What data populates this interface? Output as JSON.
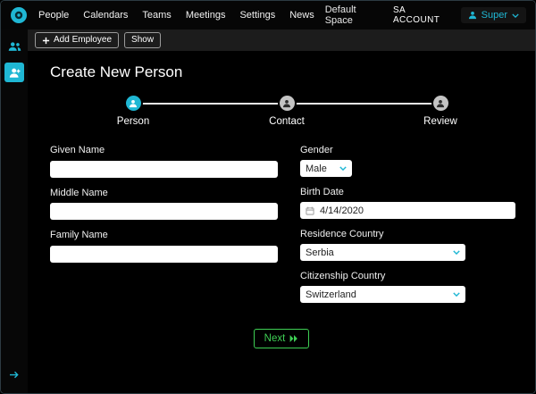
{
  "colors": {
    "accent": "#1fb7d4",
    "success": "#3ecf54"
  },
  "navbar": {
    "items": [
      "People",
      "Calendars",
      "Teams",
      "Meetings",
      "Settings",
      "News"
    ],
    "space_label": "Default Space",
    "account_label": "SA ACCOUNT",
    "user_name": "Super"
  },
  "toolbar": {
    "add_employee_label": "Add Employee",
    "show_label": "Show"
  },
  "page": {
    "title": "Create New Person"
  },
  "stepper": {
    "steps": [
      {
        "label": "Person",
        "state": "active"
      },
      {
        "label": "Contact",
        "state": "inactive"
      },
      {
        "label": "Review",
        "state": "inactive"
      }
    ]
  },
  "form": {
    "given_name": {
      "label": "Given Name",
      "value": ""
    },
    "middle_name": {
      "label": "Middle Name",
      "value": ""
    },
    "family_name": {
      "label": "Family Name",
      "value": ""
    },
    "gender": {
      "label": "Gender",
      "value": "Male"
    },
    "birth_date": {
      "label": "Birth Date",
      "value": "4/14/2020"
    },
    "residence_country": {
      "label": "Residence Country",
      "value": "Serbia"
    },
    "citizenship_country": {
      "label": "Citizenship Country",
      "value": "Switzerland"
    }
  },
  "actions": {
    "next_label": "Next"
  }
}
